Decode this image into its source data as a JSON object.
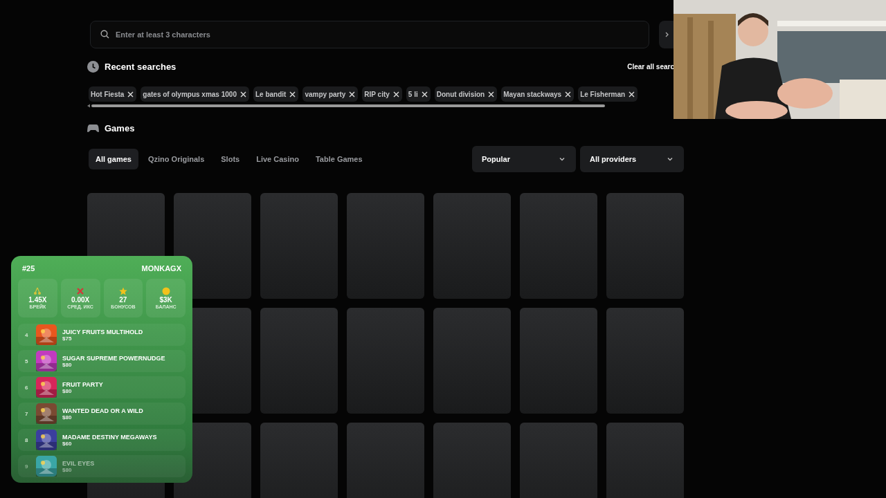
{
  "search": {
    "placeholder": "Enter at least 3 characters"
  },
  "recent": {
    "title": "Recent searches",
    "clear_label": "Clear all searc",
    "chips": [
      "Hot Fiesta",
      "gates of olympus xmas 1000",
      "Le bandit",
      "vampy party",
      "RIP city",
      "5 li",
      "Donut division",
      "Mayan stackways",
      "Le Fisherman"
    ]
  },
  "games": {
    "title": "Games",
    "tabs": [
      {
        "label": "All games",
        "selected": true
      },
      {
        "label": "Qzino Originals",
        "selected": false
      },
      {
        "label": "Slots",
        "selected": false
      },
      {
        "label": "Live Casino",
        "selected": false
      },
      {
        "label": "Table Games",
        "selected": false
      }
    ],
    "sort": "Popular",
    "provider": "All providers"
  },
  "widget": {
    "rank": "#25",
    "user": "MONKAGX",
    "stats": [
      {
        "kind": "cherry",
        "value": "1.45X",
        "label": "БРЕЙК"
      },
      {
        "kind": "cross",
        "value": "0.00X",
        "label": "СРЕД. ИКС"
      },
      {
        "kind": "star",
        "value": "27",
        "label": "БОНУСОВ"
      },
      {
        "kind": "coin",
        "value": "$3K",
        "label": "БАЛАНС"
      }
    ],
    "list": [
      {
        "rank": "4",
        "name": "JUICY FRUITS MULTIHOLD",
        "amount": "$75",
        "color": "#e8571e"
      },
      {
        "rank": "5",
        "name": "SUGAR SUPREME POWERNUDGE",
        "amount": "$80",
        "color": "#c23bbf"
      },
      {
        "rank": "6",
        "name": "FRUIT PARTY",
        "amount": "$80",
        "color": "#d7265a"
      },
      {
        "rank": "7",
        "name": "WANTED DEAD OR A WILD",
        "amount": "$80",
        "color": "#7a4a32"
      },
      {
        "rank": "8",
        "name": "MADAME DESTINY MEGAWAYS",
        "amount": "$60",
        "color": "#3b3f9e"
      },
      {
        "rank": "9",
        "name": "EVIL EYES",
        "amount": "$80",
        "color": "#3aa6a6"
      }
    ]
  }
}
